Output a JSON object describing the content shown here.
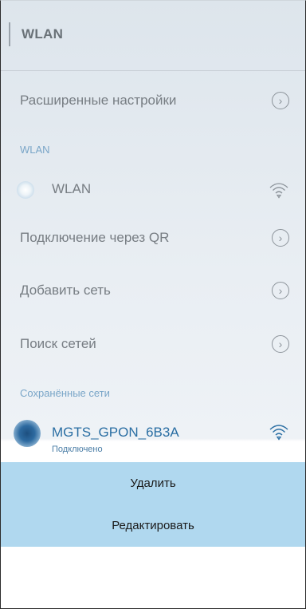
{
  "header": {
    "title": "WLAN"
  },
  "rows": {
    "advanced": {
      "label": "Расширенные настройки"
    },
    "wlan_section": {
      "label": "WLAN"
    },
    "wlan_toggle": {
      "label": "WLAN",
      "icon": "wifi-icon"
    },
    "qr": {
      "label": "Подключение через QR"
    },
    "add": {
      "label": "Добавить сеть"
    },
    "search": {
      "label": "Поиск сетей"
    }
  },
  "saved": {
    "section_label": "Сохранённые сети",
    "network": {
      "name": "MGTS_GPON_6B3A",
      "status": "Подключено",
      "icon": "wifi-icon"
    }
  },
  "context_menu": {
    "delete": "Удалить",
    "edit": "Редактировать"
  },
  "colors": {
    "accent": "#2a6ea3",
    "menu_bg": "#b0d8ef",
    "section": "#7aa6c8"
  }
}
